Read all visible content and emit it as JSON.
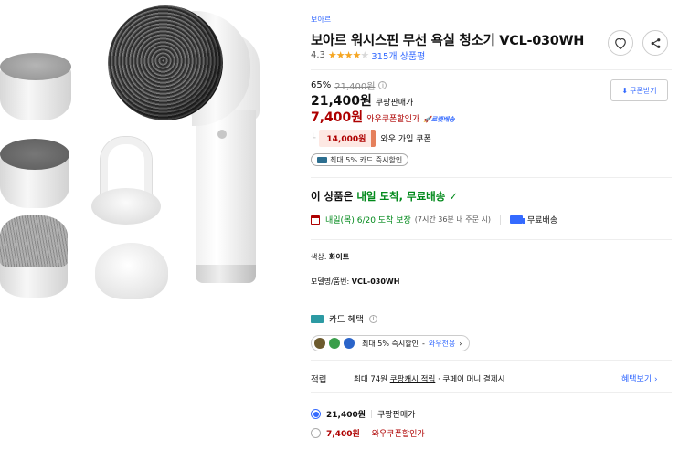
{
  "product": {
    "brand": "보아르",
    "title": "보아르 워시스핀 무선 욕실 청소기 VCL-030WH",
    "rating": "4.3",
    "stars_filled": 4,
    "stars_total": 5,
    "review_count": "315개 상품평"
  },
  "price": {
    "discount_rate": "65%",
    "original_price": "21,400원",
    "sale_price": "21,400원",
    "sale_label": "쿠팡판매가",
    "coupon_price": "7,400원",
    "coupon_label": "와우쿠폰할인가",
    "rocket_label": "로켓배송",
    "coupon_button": "쿠폰받기",
    "wow_coupon_amount": "14,000원",
    "wow_coupon_label": "와우 가입 쿠폰",
    "card_badge": "최대 5% 카드 즉시할인"
  },
  "delivery": {
    "headline_prefix": "이 상품은 ",
    "headline_highlight": "내일 도착, 무료배송",
    "check_glyph": "✓",
    "date": "내일(목) 6/20 도착 보장",
    "note": "(7시간 36분 내 주문 시)",
    "shipping": "무료배송"
  },
  "options": {
    "color_key": "색상:",
    "color_value": "화이트",
    "model_key": "모델명/품번:",
    "model_value": "VCL-030WH"
  },
  "card_benefit": {
    "title": "카드 혜택",
    "discount": "최대 5% 즉시할인",
    "dash": " - ",
    "wow_only": "와우전용",
    "chevron": "›"
  },
  "reward": {
    "key": "적립",
    "prefix": "최대 74원 ",
    "link_text": "쿠팡캐시 적립",
    "suffix": " · 쿠페이 머니 결제시",
    "more": "혜택보기 ›"
  },
  "price_options": [
    {
      "amount": "21,400원",
      "label": "쿠팡판매가",
      "selected": true
    },
    {
      "amount": "7,400원",
      "label": "와우쿠폰할인가",
      "selected": false
    }
  ],
  "colors": {
    "accent_blue": "#346aff",
    "price_red": "#ae0000",
    "delivery_green": "#00891a",
    "star_yellow": "#f5a623"
  },
  "icons": [
    "heart-icon",
    "share-icon",
    "info-icon",
    "download-icon",
    "card-icon",
    "calendar-icon",
    "truck-icon",
    "bank-icon"
  ]
}
